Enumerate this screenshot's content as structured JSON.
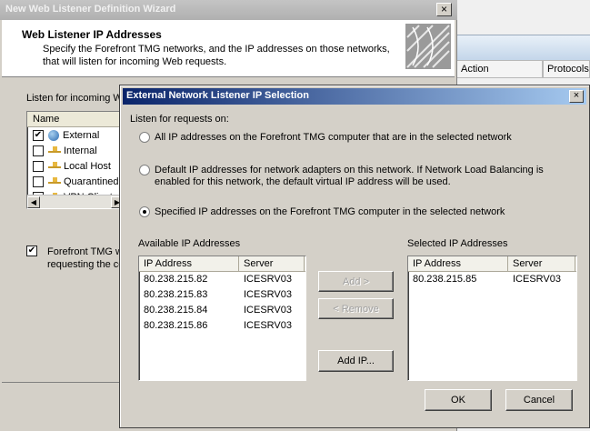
{
  "background_app": {
    "columns": [
      "Action",
      "Protocols"
    ]
  },
  "wizard": {
    "title": "New Web Listener Definition Wizard",
    "close_glyph": "×",
    "heading": "Web Listener IP Addresses",
    "description": "Specify the Forefront TMG networks, and the IP addresses on those networks, that will listen for incoming Web requests.",
    "listen_label": "Listen for incoming W",
    "list_header": "Name",
    "networks": [
      {
        "label": "External",
        "checked": true,
        "icon": "globe-icon"
      },
      {
        "label": "Internal",
        "checked": false,
        "icon": "network-icon"
      },
      {
        "label": "Local Host",
        "checked": false,
        "icon": "network-icon"
      },
      {
        "label": "Quarantined",
        "checked": false,
        "icon": "network-icon"
      },
      {
        "label": "VPN Client",
        "checked": false,
        "icon": "network-icon"
      }
    ],
    "forefront_check_line1": "Forefront TMG wil",
    "forefront_check_line2": "requesting the co"
  },
  "dialog": {
    "title": "External Network Listener IP Selection",
    "close_glyph": "×",
    "listen_label": "Listen for requests on:",
    "options": [
      {
        "label": "All IP addresses on the Forefront TMG computer that are in the selected network",
        "selected": false
      },
      {
        "label": "Default IP addresses for network adapters on this network. If Network Load Balancing is enabled for this network, the default virtual IP address will be used.",
        "selected": false
      },
      {
        "label": "Specified IP addresses on the Forefront TMG computer in the selected network",
        "selected": true
      }
    ],
    "available": {
      "label": "Available IP Addresses",
      "columns": [
        "IP Address",
        "Server"
      ],
      "rows": [
        [
          "80.238.215.82",
          "ICESRV03"
        ],
        [
          "80.238.215.83",
          "ICESRV03"
        ],
        [
          "80.238.215.84",
          "ICESRV03"
        ],
        [
          "80.238.215.86",
          "ICESRV03"
        ]
      ]
    },
    "selected": {
      "label": "Selected IP Addresses",
      "columns": [
        "IP Address",
        "Server"
      ],
      "rows": [
        [
          "80.238.215.85",
          "ICESRV03"
        ]
      ]
    },
    "buttons": {
      "add": "Add >",
      "remove": "< Remove",
      "add_ip": "Add IP...",
      "ok": "OK",
      "cancel": "Cancel"
    }
  }
}
